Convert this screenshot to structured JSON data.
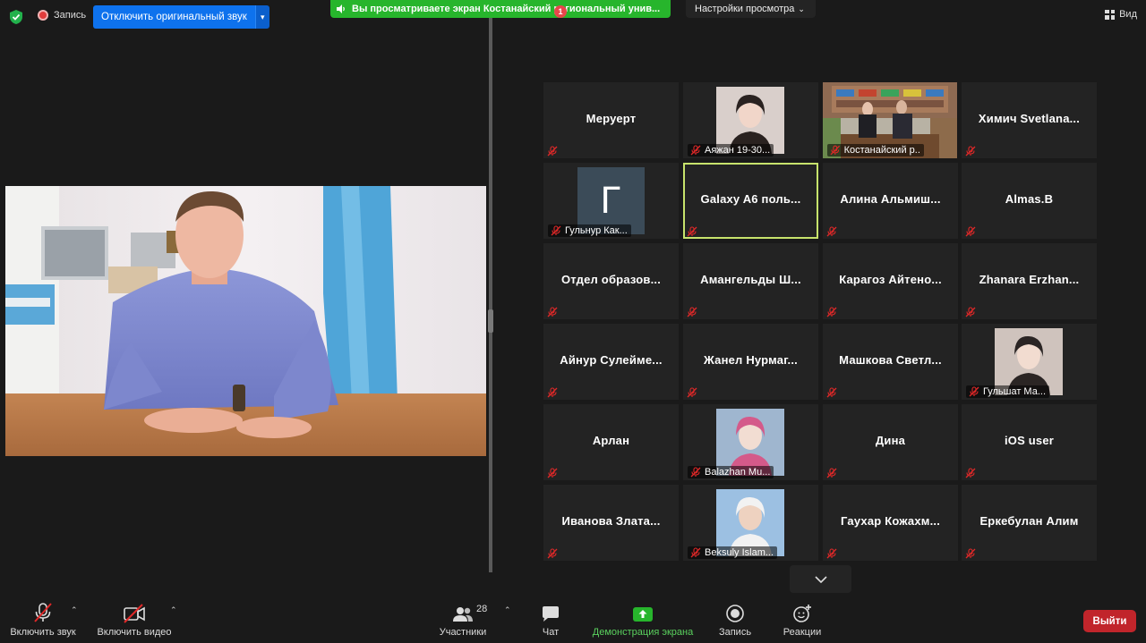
{
  "topbar": {
    "record_label": "Запись",
    "original_sound_label": "Отключить оригинальный звук",
    "share_banner": "Вы просматриваете экран Костанайский региональный унив...",
    "view_settings": "Настройки просмотра",
    "view_label": "Вид"
  },
  "gallery": {
    "tiles": [
      {
        "name": "Меруерт",
        "photo": false
      },
      {
        "name": "Аяжан 19-30...",
        "photo": true
      },
      {
        "name": "Костанайский р...",
        "photo": true
      },
      {
        "name": "Химич Svetlana..."
      },
      {
        "name": "Гульнур Как...",
        "avatar_letter": "Г"
      },
      {
        "name": "Galaxy A6 поль...",
        "active": true
      },
      {
        "name": "Алина Альмиш..."
      },
      {
        "name": "Almas.B"
      },
      {
        "name": "Отдел образов..."
      },
      {
        "name": "Амангельды Ш..."
      },
      {
        "name": "Карагоз Айтено..."
      },
      {
        "name": "Zhanara Erzhan..."
      },
      {
        "name": "Айнур Сулейме..."
      },
      {
        "name": "Жанел Нурмаг..."
      },
      {
        "name": "Машкова Светл..."
      },
      {
        "name": "Гульшат Ма...",
        "photo": true
      },
      {
        "name": "Арлан"
      },
      {
        "name": "Balazhan Mu...",
        "photo": true
      },
      {
        "name": "Дина"
      },
      {
        "name": "iOS user"
      },
      {
        "name": "Иванова Злата..."
      },
      {
        "name": "Beksuly Islam...",
        "photo": true
      },
      {
        "name": "Гаухар Кожахм..."
      },
      {
        "name": "Еркебулан Алим"
      }
    ]
  },
  "toolbar": {
    "audio_label": "Включить звук",
    "video_label": "Включить видео",
    "participants_label": "Участники",
    "participants_count": "28",
    "chat_label": "Чат",
    "chat_badge": "1",
    "share_label": "Демонстрация экрана",
    "record_label": "Запись",
    "reactions_label": "Реакции",
    "leave_label": "Выйти"
  },
  "colors": {
    "accent_blue": "#0e72ed",
    "share_green": "#27b52c",
    "leave_red": "#c1252b",
    "active_speaker": "#c7e36c",
    "muted_red": "#e02828"
  }
}
